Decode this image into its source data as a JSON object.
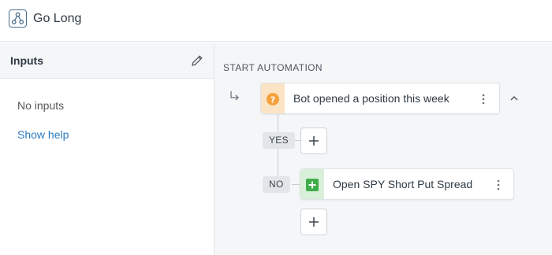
{
  "app": {
    "title": "Go Long",
    "icon": "workflow-icon"
  },
  "inputs_panel": {
    "title": "Inputs",
    "edit_icon": "pencil-icon",
    "empty_text": "No inputs",
    "help_link": "Show help"
  },
  "canvas": {
    "start_label": "START AUTOMATION",
    "trigger": {
      "label": "Bot opened a position this week",
      "icon": "question-icon",
      "icon_color": "#f5a13c"
    },
    "branches": {
      "yes_label": "YES",
      "no_label": "NO"
    },
    "action": {
      "label": "Open SPY Short Put Spread",
      "icon": "plus-square-icon",
      "icon_color": "#3fae4a"
    }
  }
}
